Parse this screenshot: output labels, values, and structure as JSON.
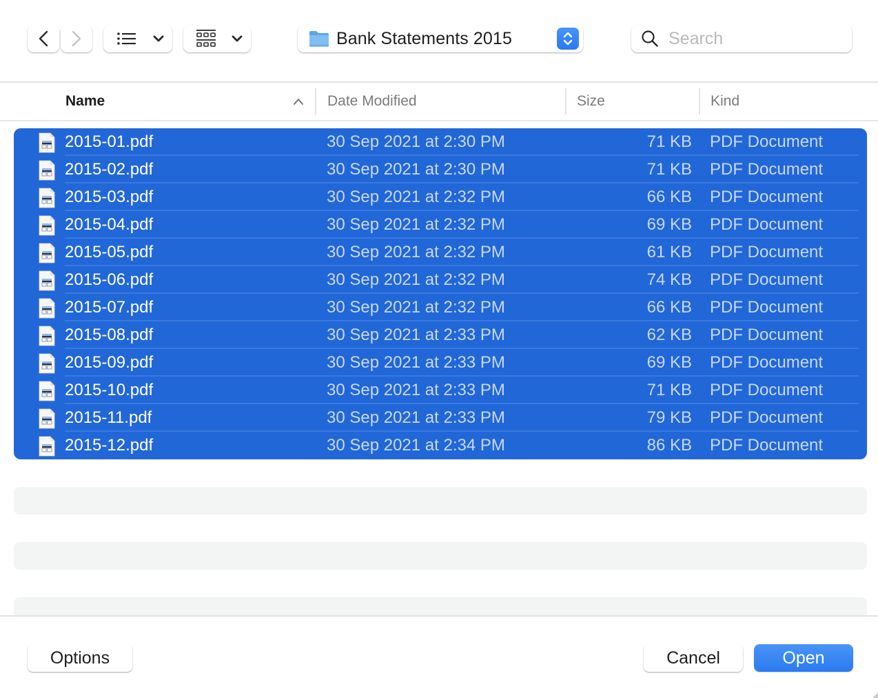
{
  "toolbar": {
    "back_icon": "chevron-left-icon",
    "forward_icon": "chevron-right-icon",
    "view_mode_icon": "list-view-icon",
    "group_icon": "group-grid-icon",
    "location": {
      "icon": "folder-icon",
      "label": "Bank Statements 2015",
      "stepper_icon": "up-down-chevron-icon"
    },
    "search": {
      "icon": "magnifier-icon",
      "placeholder": "Search",
      "value": ""
    }
  },
  "columns": {
    "name": "Name",
    "date": "Date Modified",
    "size": "Size",
    "kind": "Kind",
    "sort_column": "Name",
    "sort_direction": "ascending"
  },
  "files": [
    {
      "name": "2015-01.pdf",
      "date": "30 Sep 2021 at 2:30 PM",
      "size": "71 KB",
      "kind": "PDF Document",
      "selected": true
    },
    {
      "name": "2015-02.pdf",
      "date": "30 Sep 2021 at 2:30 PM",
      "size": "71 KB",
      "kind": "PDF Document",
      "selected": true
    },
    {
      "name": "2015-03.pdf",
      "date": "30 Sep 2021 at 2:32 PM",
      "size": "66 KB",
      "kind": "PDF Document",
      "selected": true
    },
    {
      "name": "2015-04.pdf",
      "date": "30 Sep 2021 at 2:32 PM",
      "size": "69 KB",
      "kind": "PDF Document",
      "selected": true
    },
    {
      "name": "2015-05.pdf",
      "date": "30 Sep 2021 at 2:32 PM",
      "size": "61 KB",
      "kind": "PDF Document",
      "selected": true
    },
    {
      "name": "2015-06.pdf",
      "date": "30 Sep 2021 at 2:32 PM",
      "size": "74 KB",
      "kind": "PDF Document",
      "selected": true
    },
    {
      "name": "2015-07.pdf",
      "date": "30 Sep 2021 at 2:32 PM",
      "size": "66 KB",
      "kind": "PDF Document",
      "selected": true
    },
    {
      "name": "2015-08.pdf",
      "date": "30 Sep 2021 at 2:33 PM",
      "size": "62 KB",
      "kind": "PDF Document",
      "selected": true
    },
    {
      "name": "2015-09.pdf",
      "date": "30 Sep 2021 at 2:33 PM",
      "size": "69 KB",
      "kind": "PDF Document",
      "selected": true
    },
    {
      "name": "2015-10.pdf",
      "date": "30 Sep 2021 at 2:33 PM",
      "size": "71 KB",
      "kind": "PDF Document",
      "selected": true
    },
    {
      "name": "2015-11.pdf",
      "date": "30 Sep 2021 at 2:33 PM",
      "size": "79 KB",
      "kind": "PDF Document",
      "selected": true
    },
    {
      "name": "2015-12.pdf",
      "date": "30 Sep 2021 at 2:34 PM",
      "size": "86 KB",
      "kind": "PDF Document",
      "selected": true
    }
  ],
  "footer": {
    "options_label": "Options",
    "cancel_label": "Cancel",
    "open_label": "Open"
  },
  "colors": {
    "selection": "#2167d8",
    "accent": "#2a7af1"
  }
}
